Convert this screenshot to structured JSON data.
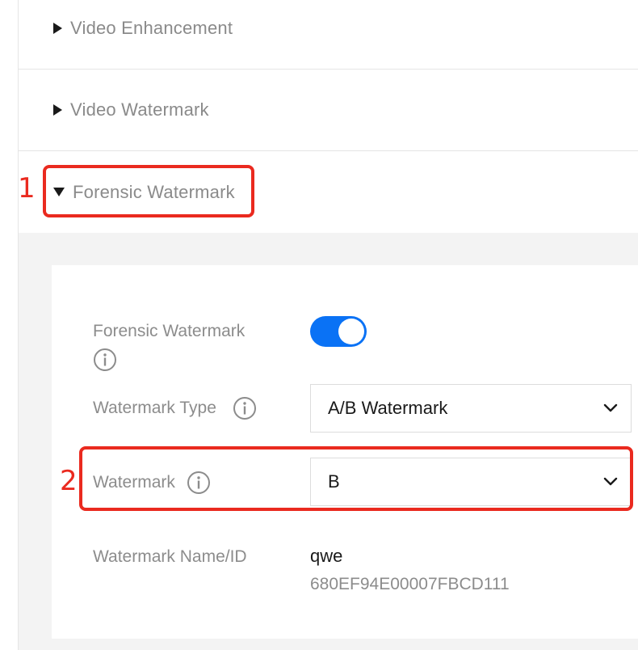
{
  "sections": [
    {
      "title": "Video Enhancement",
      "expanded": false
    },
    {
      "title": "Video Watermark",
      "expanded": false
    },
    {
      "title": "Forensic Watermark",
      "expanded": true
    }
  ],
  "panel": {
    "toggle_label": "Forensic Watermark",
    "toggle_on": true,
    "type_label": "Watermark Type",
    "type_value": "A/B Watermark",
    "watermark_label": "Watermark",
    "watermark_value": "B",
    "name_label": "Watermark Name/ID",
    "name_value": "qwe",
    "id_value": "680EF94E00007FBCD111"
  },
  "annotations": [
    "1",
    "2"
  ],
  "colors": {
    "accent": "#0a72f5",
    "annotation": "#ea2a1f"
  }
}
